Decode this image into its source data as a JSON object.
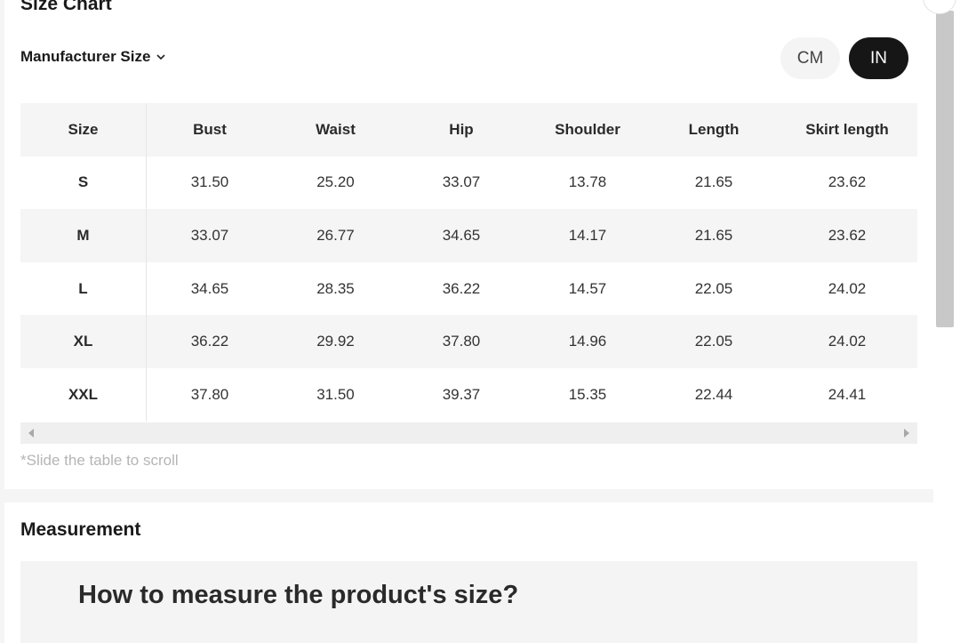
{
  "size_chart": {
    "title": "Size Chart",
    "manufacturer_label": "Manufacturer Size",
    "units": {
      "cm": "CM",
      "in": "IN",
      "selected": "IN"
    }
  },
  "table": {
    "headers": [
      "Size",
      "Bust",
      "Waist",
      "Hip",
      "Shoulder",
      "Length",
      "Skirt length"
    ],
    "rows": [
      [
        "S",
        "31.50",
        "25.20",
        "33.07",
        "13.78",
        "21.65",
        "23.62"
      ],
      [
        "M",
        "33.07",
        "26.77",
        "34.65",
        "14.17",
        "21.65",
        "23.62"
      ],
      [
        "L",
        "34.65",
        "28.35",
        "36.22",
        "14.57",
        "22.05",
        "24.02"
      ],
      [
        "XL",
        "36.22",
        "29.92",
        "37.80",
        "14.96",
        "22.05",
        "24.02"
      ],
      [
        "XXL",
        "37.80",
        "31.50",
        "39.37",
        "15.35",
        "22.44",
        "24.41"
      ]
    ]
  },
  "hint": "*Slide the table to scroll",
  "measurement": {
    "title": "Measurement",
    "howto": "How to measure the product's size?"
  },
  "icons": {
    "dropdown": "chevron-down-icon",
    "scroll_left": "arrow-left-icon",
    "scroll_right": "arrow-right-icon"
  },
  "colors": {
    "selected_unit_bg": "#161616",
    "unselected_unit_bg": "#f4f4f4",
    "row_shade": "#f5f5f5"
  }
}
